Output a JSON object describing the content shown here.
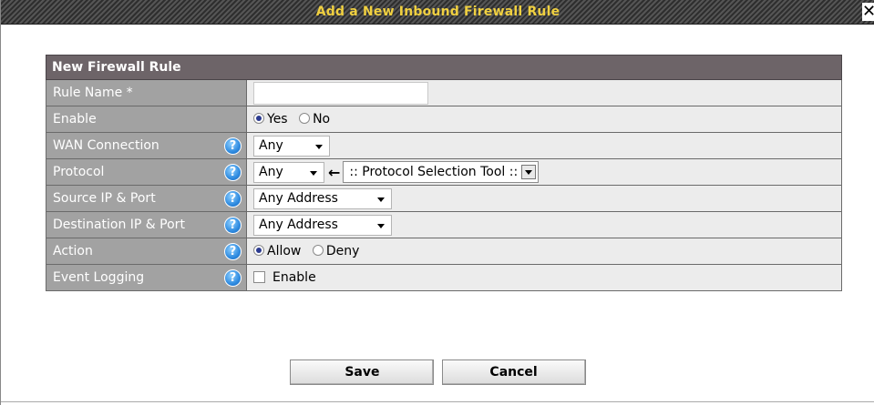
{
  "dialog": {
    "title": "Add a New Inbound Firewall Rule",
    "close_label": "✕"
  },
  "table": {
    "header": "New Firewall Rule",
    "rows": {
      "rule_name": {
        "label": "Rule Name *",
        "value": ""
      },
      "enable": {
        "label": "Enable",
        "yes": "Yes",
        "no": "No",
        "selected": "Yes"
      },
      "wan": {
        "label": "WAN Connection",
        "selected": "Any"
      },
      "protocol": {
        "label": "Protocol",
        "selected": "Any",
        "arrow": "←",
        "tool": ":: Protocol Selection Tool ::"
      },
      "source": {
        "label": "Source IP & Port",
        "selected": "Any Address"
      },
      "destination": {
        "label": "Destination IP & Port",
        "selected": "Any Address"
      },
      "action": {
        "label": "Action",
        "allow": "Allow",
        "deny": "Deny",
        "selected": "Allow"
      },
      "logging": {
        "label": "Event Logging",
        "checkbox_label": "Enable",
        "checked": false
      }
    },
    "help_glyph": "?"
  },
  "buttons": {
    "save": "Save",
    "cancel": "Cancel"
  },
  "colors": {
    "title_text": "#f0d040",
    "header_bg": "#6d6468",
    "label_bg": "#a2a2a2",
    "value_bg": "#ececec",
    "help_icon": "#2f8be0"
  }
}
